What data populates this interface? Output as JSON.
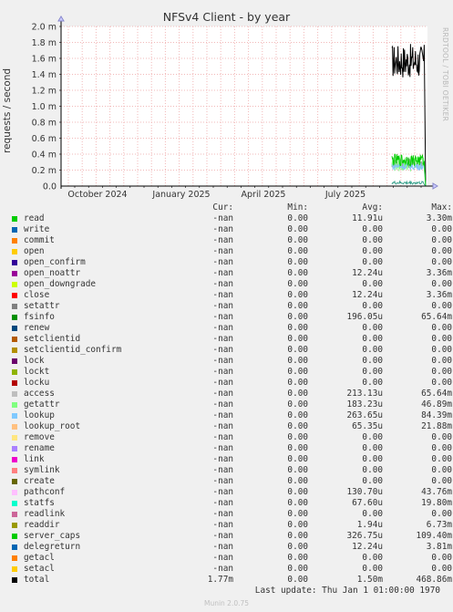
{
  "title": "NFSv4 Client - by year",
  "ylabel": "requests / second",
  "credit": "RRDTOOL / TOBI OETIKER",
  "last_update": "Last update: Thu Jan  1 01:00:00 1970",
  "footer": "Munin 2.0.75",
  "legend_headers": {
    "cur": "Cur:",
    "min": "Min:",
    "avg": "Avg:",
    "max": "Max:"
  },
  "chart_data": {
    "type": "line",
    "title": "NFSv4 Client - by year",
    "ylabel": "requests / second",
    "xlabel": "",
    "yticks": [
      "0.0",
      "0.2 m",
      "0.4 m",
      "0.6 m",
      "0.8 m",
      "1.0 m",
      "1.2 m",
      "1.4 m",
      "1.6 m",
      "1.8 m",
      "2.0 m"
    ],
    "ylim": [
      0,
      0.002
    ],
    "xticks": [
      "October 2024",
      "January 2025",
      "April 2025",
      "July 2025"
    ],
    "grid": true,
    "series": [
      {
        "name": "total",
        "color": "#000000",
        "band": [
          0.00135,
          0.00178
        ],
        "end_value": 0.0
      },
      {
        "name": "access",
        "color": "#999999",
        "band": [
          0.00022,
          0.00036
        ],
        "end_value": 0.0
      },
      {
        "name": "getattr",
        "color": "#7cfc7c",
        "band": [
          0.00018,
          0.00038
        ],
        "end_value": 0.0
      },
      {
        "name": "lookup",
        "color": "#87c3fa",
        "band": [
          0.0002,
          0.0003
        ],
        "end_value": 0.0
      },
      {
        "name": "server_caps",
        "color": "#00cc00",
        "band": [
          0.00025,
          0.0004
        ],
        "end_value": 0.0
      },
      {
        "name": "fsinfo",
        "color": "#36a18b",
        "band": [
          2e-05,
          6e-05
        ],
        "end_value": 0.0
      }
    ],
    "rows": [
      {
        "name": "read",
        "color": "#00cc00",
        "cur": "-nan",
        "min": "0.00",
        "avg": "11.91u",
        "max": "3.30m"
      },
      {
        "name": "write",
        "color": "#0066b3",
        "cur": "-nan",
        "min": "0.00",
        "avg": "0.00",
        "max": "0.00"
      },
      {
        "name": "commit",
        "color": "#ff8000",
        "cur": "-nan",
        "min": "0.00",
        "avg": "0.00",
        "max": "0.00"
      },
      {
        "name": "open",
        "color": "#ffcc00",
        "cur": "-nan",
        "min": "0.00",
        "avg": "0.00",
        "max": "0.00"
      },
      {
        "name": "open_confirm",
        "color": "#330099",
        "cur": "-nan",
        "min": "0.00",
        "avg": "0.00",
        "max": "0.00"
      },
      {
        "name": "open_noattr",
        "color": "#990099",
        "cur": "-nan",
        "min": "0.00",
        "avg": "12.24u",
        "max": "3.36m"
      },
      {
        "name": "open_downgrade",
        "color": "#ccff00",
        "cur": "-nan",
        "min": "0.00",
        "avg": "0.00",
        "max": "0.00"
      },
      {
        "name": "close",
        "color": "#ff0000",
        "cur": "-nan",
        "min": "0.00",
        "avg": "12.24u",
        "max": "3.36m"
      },
      {
        "name": "setattr",
        "color": "#808080",
        "cur": "-nan",
        "min": "0.00",
        "avg": "0.00",
        "max": "0.00"
      },
      {
        "name": "fsinfo",
        "color": "#008f00",
        "cur": "-nan",
        "min": "0.00",
        "avg": "196.05u",
        "max": "65.64m"
      },
      {
        "name": "renew",
        "color": "#00487d",
        "cur": "-nan",
        "min": "0.00",
        "avg": "0.00",
        "max": "0.00"
      },
      {
        "name": "setclientid",
        "color": "#b35a00",
        "cur": "-nan",
        "min": "0.00",
        "avg": "0.00",
        "max": "0.00"
      },
      {
        "name": "setclientid_confirm",
        "color": "#b38f00",
        "cur": "-nan",
        "min": "0.00",
        "avg": "0.00",
        "max": "0.00"
      },
      {
        "name": "lock",
        "color": "#6b006b",
        "cur": "-nan",
        "min": "0.00",
        "avg": "0.00",
        "max": "0.00"
      },
      {
        "name": "lockt",
        "color": "#8fb300",
        "cur": "-nan",
        "min": "0.00",
        "avg": "0.00",
        "max": "0.00"
      },
      {
        "name": "locku",
        "color": "#b30000",
        "cur": "-nan",
        "min": "0.00",
        "avg": "0.00",
        "max": "0.00"
      },
      {
        "name": "access",
        "color": "#bebebe",
        "cur": "-nan",
        "min": "0.00",
        "avg": "213.13u",
        "max": "65.64m"
      },
      {
        "name": "getattr",
        "color": "#80ff80",
        "cur": "-nan",
        "min": "0.00",
        "avg": "183.23u",
        "max": "46.89m"
      },
      {
        "name": "lookup",
        "color": "#80c9ff",
        "cur": "-nan",
        "min": "0.00",
        "avg": "263.65u",
        "max": "84.39m"
      },
      {
        "name": "lookup_root",
        "color": "#ffc080",
        "cur": "-nan",
        "min": "0.00",
        "avg": "65.35u",
        "max": "21.88m"
      },
      {
        "name": "remove",
        "color": "#ffe680",
        "cur": "-nan",
        "min": "0.00",
        "avg": "0.00",
        "max": "0.00"
      },
      {
        "name": "rename",
        "color": "#aa80ff",
        "cur": "-nan",
        "min": "0.00",
        "avg": "0.00",
        "max": "0.00"
      },
      {
        "name": "link",
        "color": "#ee00cc",
        "cur": "-nan",
        "min": "0.00",
        "avg": "0.00",
        "max": "0.00"
      },
      {
        "name": "symlink",
        "color": "#ff8080",
        "cur": "-nan",
        "min": "0.00",
        "avg": "0.00",
        "max": "0.00"
      },
      {
        "name": "create",
        "color": "#666600",
        "cur": "-nan",
        "min": "0.00",
        "avg": "0.00",
        "max": "0.00"
      },
      {
        "name": "pathconf",
        "color": "#ffbfff",
        "cur": "-nan",
        "min": "0.00",
        "avg": "130.70u",
        "max": "43.76m"
      },
      {
        "name": "statfs",
        "color": "#00ffcc",
        "cur": "-nan",
        "min": "0.00",
        "avg": "67.60u",
        "max": "19.80m"
      },
      {
        "name": "readlink",
        "color": "#cc6699",
        "cur": "-nan",
        "min": "0.00",
        "avg": "0.00",
        "max": "0.00"
      },
      {
        "name": "readdir",
        "color": "#999900",
        "cur": "-nan",
        "min": "0.00",
        "avg": "1.94u",
        "max": "6.73m"
      },
      {
        "name": "server_caps",
        "color": "#00cc00",
        "cur": "-nan",
        "min": "0.00",
        "avg": "326.75u",
        "max": "109.40m"
      },
      {
        "name": "delegreturn",
        "color": "#0066b3",
        "cur": "-nan",
        "min": "0.00",
        "avg": "12.24u",
        "max": "3.81m"
      },
      {
        "name": "getacl",
        "color": "#ff8000",
        "cur": "-nan",
        "min": "0.00",
        "avg": "0.00",
        "max": "0.00"
      },
      {
        "name": "setacl",
        "color": "#ffcc00",
        "cur": "-nan",
        "min": "0.00",
        "avg": "0.00",
        "max": "0.00"
      },
      {
        "name": "total",
        "color": "#000000",
        "cur": "1.77m",
        "min": "0.00",
        "avg": "1.50m",
        "max": "468.86m"
      }
    ]
  }
}
